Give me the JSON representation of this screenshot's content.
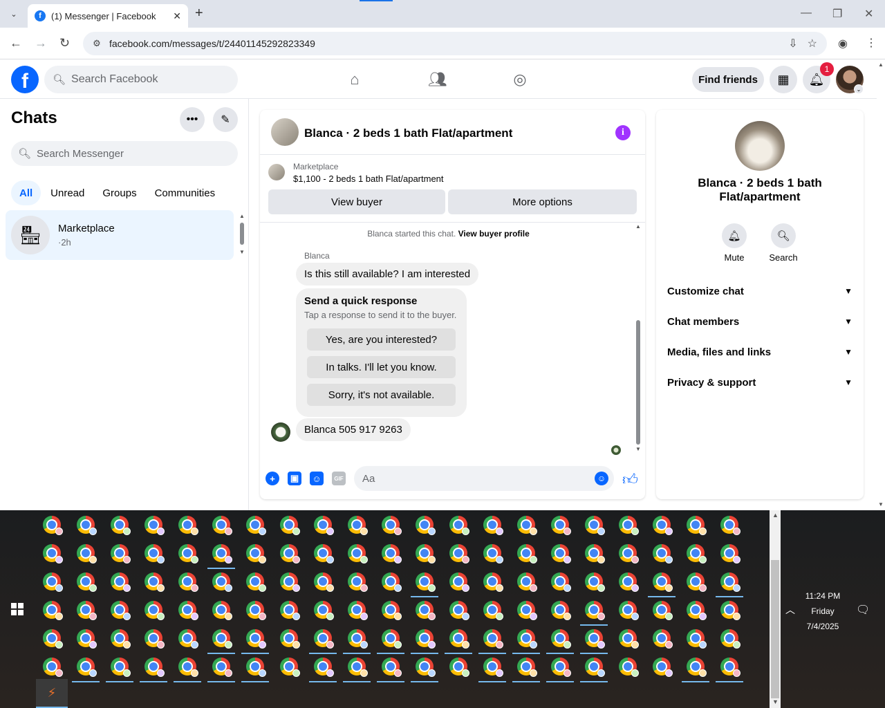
{
  "browser": {
    "tab_title": "(1) Messenger | Facebook",
    "url": "facebook.com/messages/t/24401145292823349"
  },
  "fb_header": {
    "search_placeholder": "Search Facebook",
    "find_friends": "Find friends",
    "notification_count": "1"
  },
  "sidebar": {
    "title": "Chats",
    "search_placeholder": "Search Messenger",
    "filters": [
      "All",
      "Unread",
      "Groups",
      "Communities"
    ],
    "chats": [
      {
        "name": "Marketplace",
        "time": "·2h"
      }
    ]
  },
  "conversation": {
    "title": "Blanca · 2 beds 1 bath Flat/apartment",
    "marketplace_label": "Marketplace",
    "listing": "$1,100 - 2 beds 1 bath Flat/apartment",
    "view_buyer": "View buyer",
    "more_options": "More options",
    "started_text": "Blanca started this chat.",
    "view_buyer_profile": "View buyer profile",
    "sender": "Blanca",
    "message1": "Is this still available? I am interested",
    "quick_title": "Send a quick response",
    "quick_subtitle": "Tap a response to send it to the buyer.",
    "quick_replies": [
      "Yes, are you interested?",
      "In talks. I'll let you know.",
      "Sorry, it's not available."
    ],
    "message2": "Blanca 505 917 9263",
    "composer_placeholder": "Aa"
  },
  "info_panel": {
    "name": "Blanca · 2 beds 1 bath Flat/apartment",
    "actions": [
      "Mute",
      "Search"
    ],
    "sections": [
      "Customize chat",
      "Chat members",
      "Media, files and links",
      "Privacy & support"
    ]
  },
  "taskbar": {
    "time": "11:24 PM",
    "day": "Friday",
    "date": "7/4/2025"
  }
}
